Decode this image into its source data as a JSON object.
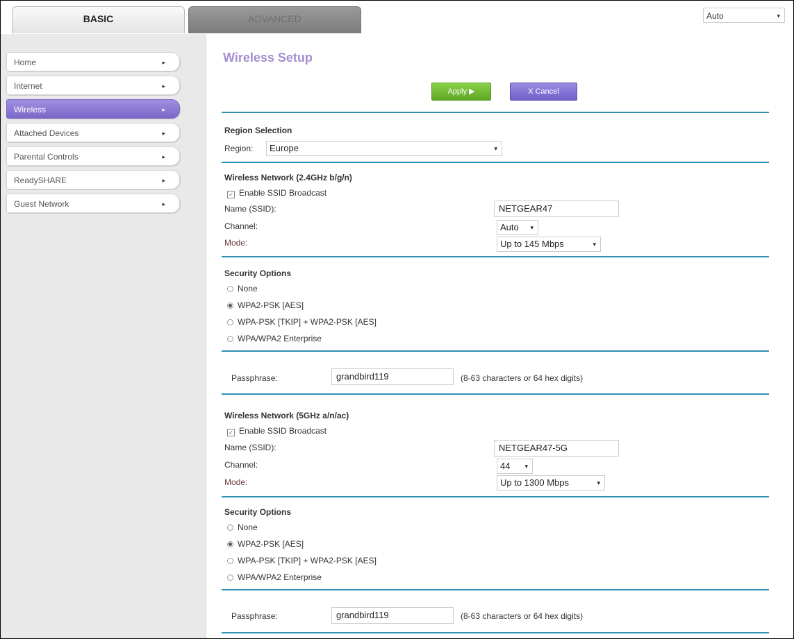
{
  "tabs": {
    "basic": "BASIC",
    "advanced": "ADVANCED"
  },
  "language_select": "Auto",
  "sidebar": {
    "items": [
      {
        "label": "Home"
      },
      {
        "label": "Internet"
      },
      {
        "label": "Wireless",
        "active": true
      },
      {
        "label": "Attached Devices"
      },
      {
        "label": "Parental Controls"
      },
      {
        "label": "ReadySHARE"
      },
      {
        "label": "Guest Network"
      }
    ]
  },
  "page": {
    "title": "Wireless Setup",
    "apply_label": "Apply ▶",
    "cancel_label": "X Cancel"
  },
  "region": {
    "section_title": "Region Selection",
    "label": "Region:",
    "value": "Europe"
  },
  "net24": {
    "section_title": "Wireless Network (2.4GHz b/g/n)",
    "ssid_broadcast_label": "Enable SSID Broadcast",
    "name_label": "Name (SSID):",
    "name_value": "NETGEAR47",
    "channel_label": "Channel:",
    "channel_value": "Auto",
    "mode_label": "Mode:",
    "mode_value": "Up to 145 Mbps",
    "security_title": "Security Options",
    "options": [
      "None",
      "WPA2-PSK [AES]",
      "WPA-PSK [TKIP] + WPA2-PSK [AES]",
      "WPA/WPA2 Enterprise"
    ],
    "selected_option": "WPA2-PSK [AES]",
    "passphrase_label": "Passphrase:",
    "passphrase_value": "grandbird119",
    "passphrase_hint": "(8-63 characters or 64 hex digits)"
  },
  "net5": {
    "section_title": "Wireless Network (5GHz a/n/ac)",
    "ssid_broadcast_label": "Enable SSID Broadcast",
    "name_label": "Name (SSID):",
    "name_value": "NETGEAR47-5G",
    "channel_label": "Channel:",
    "channel_value": "44",
    "mode_label": "Mode:",
    "mode_value": "Up to 1300 Mbps",
    "security_title": "Security Options",
    "options": [
      "None",
      "WPA2-PSK [AES]",
      "WPA-PSK [TKIP] + WPA2-PSK [AES]",
      "WPA/WPA2 Enterprise"
    ],
    "selected_option": "WPA2-PSK [AES]",
    "passphrase_label": "Passphrase:",
    "passphrase_value": "grandbird119",
    "passphrase_hint": "(8-63 characters or 64 hex digits)"
  },
  "colors": {
    "accent_purple": "#a48fd0",
    "rule_blue": "#2f8fb5",
    "apply_green": "#6fba34",
    "cancel_purple": "#7f6fd4"
  },
  "icons": {
    "dropdown": "▾",
    "nav_arrow": "▸",
    "checkbox_check": "✓"
  }
}
